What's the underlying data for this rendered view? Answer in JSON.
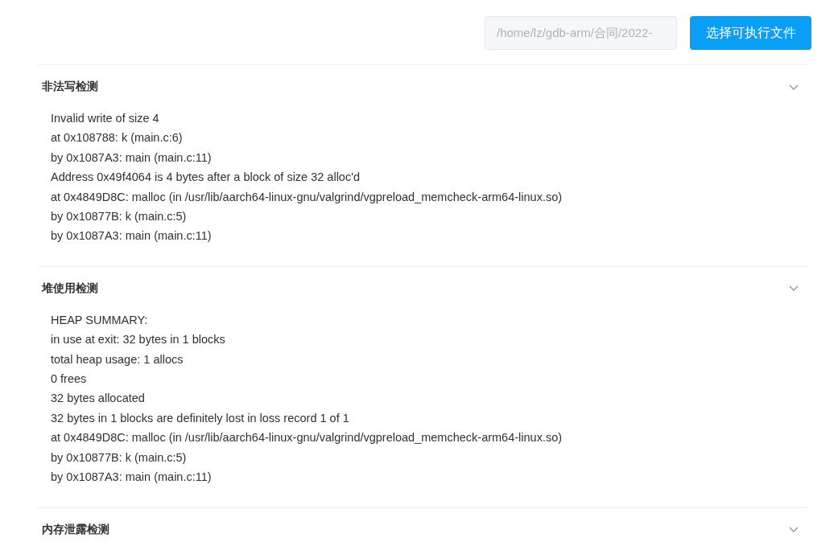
{
  "file_path": {
    "value": "/home/lz/gdb-arm/合同/2022-",
    "disabled": true
  },
  "select_button": {
    "label": "选择可执行文件"
  },
  "sections": [
    {
      "title": "非法写检测",
      "expanded": true,
      "lines": [
        "Invalid write of size 4",
        "at 0x108788: k (main.c:6)",
        "by 0x1087A3: main (main.c:11)",
        "Address 0x49f4064 is 4 bytes after a block of size 32 alloc'd",
        "at 0x4849D8C: malloc (in /usr/lib/aarch64-linux-gnu/valgrind/vgpreload_memcheck-arm64-linux.so)",
        "by 0x10877B: k (main.c:5)",
        "by 0x1087A3: main (main.c:11)"
      ]
    },
    {
      "title": "堆使用检测",
      "expanded": true,
      "lines": [
        "HEAP SUMMARY:",
        "in use at exit: 32 bytes in 1 blocks",
        "total heap usage: 1 allocs",
        "0 frees",
        "32 bytes allocated",
        "32 bytes in 1 blocks are definitely lost in loss record 1 of 1",
        "at 0x4849D8C: malloc (in /usr/lib/aarch64-linux-gnu/valgrind/vgpreload_memcheck-arm64-linux.so)",
        "by 0x10877B: k (main.c:5)",
        "by 0x1087A3: main (main.c:11)"
      ]
    },
    {
      "title": "内存泄露检测",
      "expanded": false
    }
  ]
}
